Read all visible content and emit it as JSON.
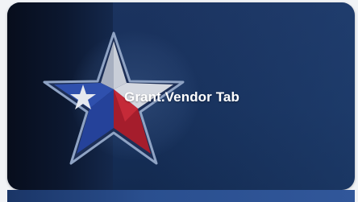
{
  "tile": {
    "title": "Grant.Vendor Tab",
    "icon": "texas-star-icon",
    "colors": {
      "background": "#17305a",
      "star_blue": "#2f4fa8",
      "star_red": "#a81f2e",
      "star_white": "#d8dbe2",
      "title_text": "#ffffff"
    }
  }
}
